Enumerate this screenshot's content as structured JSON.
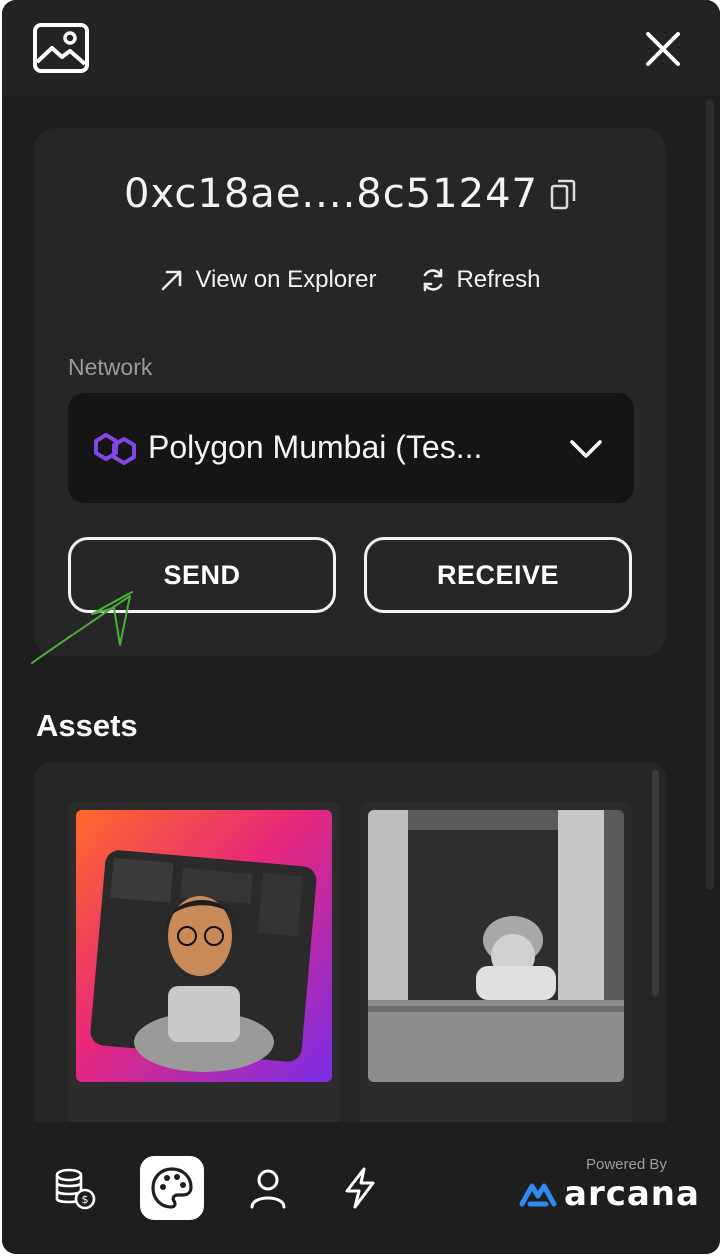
{
  "header": {
    "gallery_icon": "image-icon",
    "close_icon": "close-icon"
  },
  "wallet": {
    "address": "0xc18ae....8c51247",
    "copy_icon": "copy-icon",
    "view_explorer_label": "View on Explorer",
    "refresh_label": "Refresh"
  },
  "network": {
    "label": "Network",
    "selected": "Polygon Mumbai (Tes...",
    "icon": "polygon-icon",
    "accent": "#8247e5"
  },
  "actions": {
    "send_label": "SEND",
    "receive_label": "RECEIVE"
  },
  "assets": {
    "title": "Assets",
    "items": [
      {
        "name": "avatar-nft",
        "kind": "3d-avatar"
      },
      {
        "name": "photo-nft",
        "kind": "bw-photo"
      }
    ]
  },
  "bottom_nav": {
    "items": [
      {
        "name": "tokens-tab",
        "icon": "coins-icon"
      },
      {
        "name": "nfts-tab",
        "icon": "palette-icon",
        "active": true
      },
      {
        "name": "profile-tab",
        "icon": "user-icon"
      },
      {
        "name": "activity-tab",
        "icon": "lightning-icon"
      }
    ],
    "powered_by": "Powered By",
    "brand": "arcana",
    "brand_color": "#2f8af5"
  }
}
